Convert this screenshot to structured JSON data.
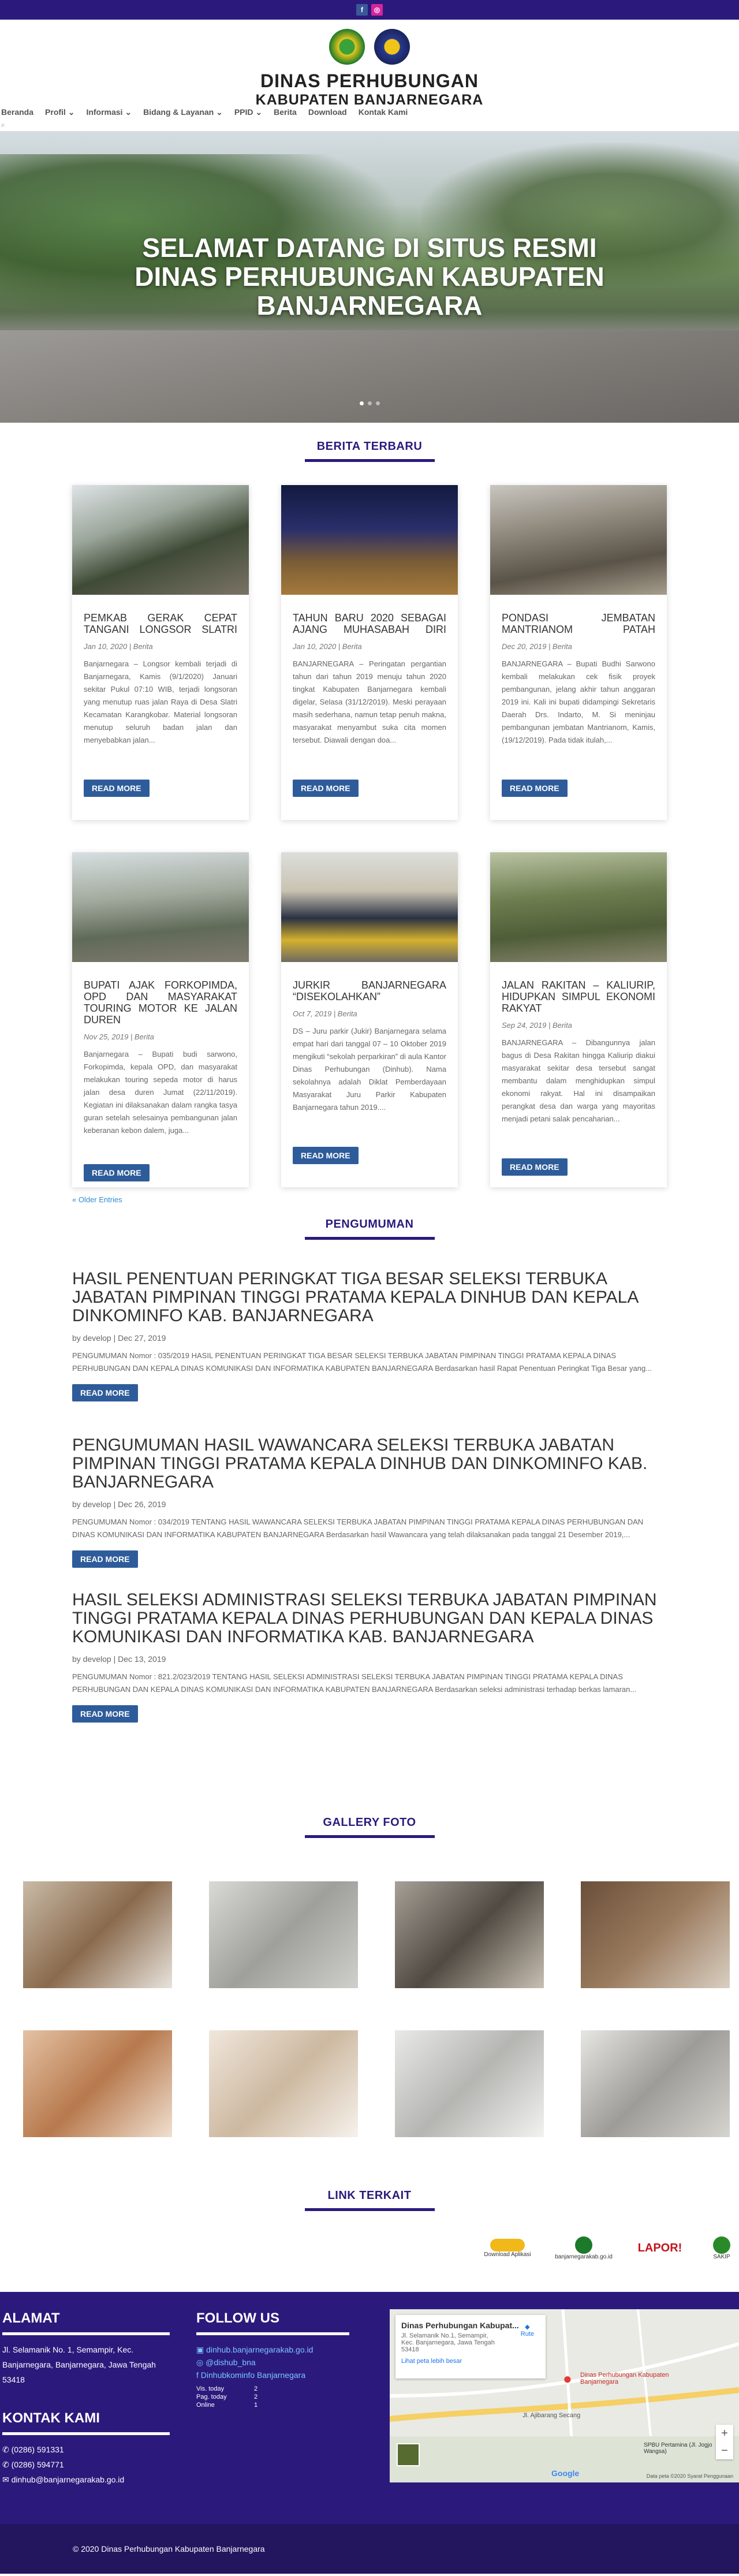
{
  "top": {
    "fb": "f",
    "ig": "◎"
  },
  "header": {
    "title": "DINAS PERHUBUNGAN",
    "subtitle": "KABUPATEN BANJARNEGARA"
  },
  "nav": [
    "Beranda",
    "Profil ⌄",
    "Informasi ⌄",
    "Bidang & Layanan ⌄",
    "PPID ⌄",
    "Berita",
    "Download",
    "Kontak Kami"
  ],
  "search": "⌕",
  "hero": {
    "line1": "SELAMAT DATANG DI SITUS RESMI",
    "line2": "DINAS PERHUBUNGAN KABUPATEN",
    "line3": "BANJARNEGARA"
  },
  "news": {
    "title": "BERITA TERBARU",
    "read_more": "READ MORE",
    "older": "« Older Entries",
    "items": [
      {
        "title": "PEMKAB GERAK CEPAT TANGANI LONGSOR SLATRI",
        "meta": "Jan 10, 2020 | Berita",
        "excerpt": "Banjarnegara – Longsor kembali terjadi di Banjarnegara, Kamis (9/1/2020) Januari sekitar Pukul 07:10 WIB, terjadi longsoran yang menutup ruas jalan Raya di Desa Slatri Kecamatan Karangkobar. Material longsoran menutup seluruh badan jalan dan menyebabkan jalan...",
        "img": "road"
      },
      {
        "title": "TAHUN BARU 2020 SEBAGAI AJANG MUHASABAH DIRI",
        "meta": "Jan 10, 2020 | Berita",
        "excerpt": "BANJARNEGARA – Peringatan pergantian tahun dari tahun 2019 menuju tahun 2020 tingkat Kabupaten Banjarnegara kembali digelar, Selasa (31/12/2019). Meski perayaan masih sederhana, namun tetap penuh makna, masyarakat menyambut suka cita momen tersebut. Diawali dengan doa...",
        "img": "stage"
      },
      {
        "title": "PONDASI JEMBATAN MANTRIANOM PATAH",
        "meta": "Dec 20, 2019 | Berita",
        "excerpt": "BANJARNEGARA – Bupati Budhi Sarwono kembali melakukan cek fisik proyek pembangunan, jelang akhir tahun anggaran 2019 ini. Kali ini bupati didampingi Sekretaris Daerah Drs. Indarto, M. Si meninjau pembangunan jembatan Mantrianom, Kamis, (19/12/2019). Pada tidak itulah,...",
        "img": "bridge"
      },
      {
        "title": "BUPATI AJAK FORKOPIMDA, OPD DAN MASYARAKAT TOURING MOTOR KE JALAN DUREN",
        "meta": "Nov 25, 2019 | Berita",
        "excerpt": "Banjarnegara – Bupati budi sarwono, Forkopimda, kepala OPD, dan masyarakat melakukan touring sepeda motor di harus jalan desa duren Jumat (22/11/2019). Kegiatan ini dilaksanakan dalam rangka tasya guran setelah selesainya pembangunan jalan keberanan kebon dalem, juga...",
        "img": "moto"
      },
      {
        "title": "JURKIR BANJARNEGARA “DISEKOLAHKAN”",
        "meta": "Oct 7, 2019 | Berita",
        "excerpt": "DS – Juru parkir (Jukir) Banjarnegara selama empat hari dari tanggal 07 – 10 Oktober 2019 mengikuti “sekolah perparkiran” di aula Kantor Dinas Perhubungan (Dinhub). Nama sekolahnya adalah Diklat Pemberdayaan Masyarakat Juru Parkir Kabupaten Banjarnegara tahun 2019....",
        "img": "people"
      },
      {
        "title": "JALAN RAKITAN – KALIURIP, HIDUPKAN SIMPUL EKONOMI RAKYAT",
        "meta": "Sep 24, 2019 | Berita",
        "excerpt": "BANJARNEGARA – Dibangunnya jalan bagus di Desa Rakitan hingga Kaliurip diakui masyarakat sekitar desa tersebut sangat membantu dalam menghidupkan simpul ekonomi rakyat. Hal ini disampaikan perangkat desa dan warga yang mayoritas menjadi petani salak pencaharian...",
        "img": "farm"
      }
    ]
  },
  "announce": {
    "title": "PENGUMUMAN",
    "read_more": "READ MORE",
    "items": [
      {
        "title": "HASIL PENENTUAN PERINGKAT TIGA BESAR SELEKSI TERBUKA JABATAN PIMPINAN TINGGI PRATAMA KEPALA DINHUB DAN KEPALA DINKOMINFO KAB. BANJARNEGARA",
        "meta": "by develop | Dec 27, 2019",
        "text": "PENGUMUMAN Nomor : 035/2019 HASIL PENENTUAN PERINGKAT TIGA BESAR SELEKSI TERBUKA JABATAN PIMPINAN TINGGI PRATAMA KEPALA DINAS PERHUBUNGAN DAN KEPALA DINAS KOMUNIKASI DAN INFORMATIKA KABUPATEN BANJARNEGARA Berdasarkan hasil Rapat Penentuan Peringkat Tiga Besar yang..."
      },
      {
        "title": "PENGUMUMAN HASIL WAWANCARA SELEKSI TERBUKA JABATAN PIMPINAN TINGGI PRATAMA KEPALA DINHUB DAN DINKOMINFO KAB. BANJARNEGARA",
        "meta": "by develop | Dec 26, 2019",
        "text": "PENGUMUMAN Nomor : 034/2019 TENTANG HASIL WAWANCARA SELEKSI TERBUKA JABATAN PIMPINAN TINGGI PRATAMA KEPALA DINAS PERHUBUNGAN DAN DINAS KOMUNIKASI DAN INFORMATIKA KABUPATEN BANJARNEGARA Berdasarkan hasil Wawancara yang telah dilaksanakan pada tanggal 21 Desember 2019,..."
      },
      {
        "title": "HASIL SELEKSI ADMINISTRASI SELEKSI TERBUKA JABATAN PIMPINAN TINGGI PRATAMA KEPALA DINAS PERHUBUNGAN DAN KEPALA DINAS KOMUNIKASI DAN INFORMATIKA KAB. BANJARNEGARA",
        "meta": "by develop | Dec 13, 2019",
        "text": "PENGUMUMAN Nomor : 821.2/023/2019 TENTANG HASIL SELEKSI ADMINISTRASI SELEKSI TERBUKA JABATAN PIMPINAN TINGGI PRATAMA KEPALA DINAS PERHUBUNGAN DAN KEPALA DINAS KOMUNIKASI DAN INFORMATIKA KABUPATEN BANJARNEGARA Berdasarkan seleksi administrasi terhadap berkas lamaran..."
      }
    ]
  },
  "gallery": {
    "title": "GALLERY FOTO"
  },
  "links": {
    "title": "LINK TERKAIT",
    "items": [
      "Download Aplikasi",
      "banjarnegarakab.go.id",
      "LAPOR!",
      "SAKIP"
    ]
  },
  "footer": {
    "alamat_h": "ALAMAT",
    "alamat": "Jl. Selamanik No. 1, Semampir, Kec. Banjarnegara, Banjarnegara, Jawa Tengah 53418",
    "kontak_h": "KONTAK KAMI",
    "phone1": "(0286) 591331",
    "phone2": "(0286) 594771",
    "email": "dinhub@banjarnegarakab.go.id",
    "follow_h": "FOLLOW US",
    "web": "dinhub.banjarnegarakab.go.id",
    "ig": "@dishub_bna",
    "fb": "Dinhubkominfo Banjarnegara",
    "stats": [
      [
        "Vis. today",
        "2"
      ],
      [
        "Pag. today",
        "2"
      ],
      [
        "Online",
        "1"
      ]
    ],
    "map_title": "Dinas Perhubungan Kabupat...",
    "map_addr": "Jl. Selamanik No.1, Semampir, Kec. Banjarnegara, Jawa Tengah 53418",
    "map_route": "Rute",
    "map_link": "Lihat peta lebih besar",
    "map_pin": "Dinas Perhubungan Kabupaten Banjarnegara",
    "map_road": "Jl. Ajibarang Secang",
    "map_spbu": "SPBU Pertamina (Jl. Jogjo Wangsa)",
    "map_foot": "Data peta ©2020   Syarat Penggunaan",
    "copyright": "© 2020 Dinas Perhubungan Kabupaten Banjarnegara"
  }
}
